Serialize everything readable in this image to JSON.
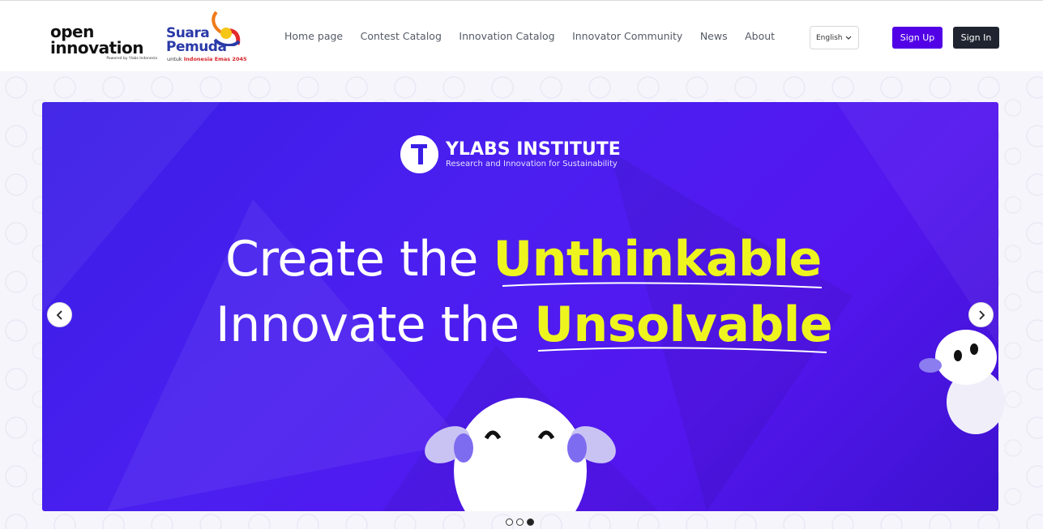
{
  "header": {
    "logo_open": {
      "line1": "open",
      "line2": "innovation",
      "powered": "Powered by Ylabs Indonesia"
    },
    "logo_suara": {
      "line1": "Suara",
      "line2": "Pemuda",
      "tag_prefix": "untuk",
      "tag_highlight": "Indonesia Emas 2045"
    },
    "nav": [
      "Home page",
      "Contest Catalog",
      "Innovation Catalog",
      "Innovator Community",
      "News",
      "About"
    ],
    "language": {
      "selected": "English",
      "icon": "chevron-down-icon"
    },
    "signup_label": "Sign Up",
    "signin_label": "Sign In"
  },
  "banner": {
    "brand_title": "YLABS INSTITUTE",
    "brand_subtitle": "Research and Innovation for Sustainability",
    "line1_plain": "Create the ",
    "line1_highlight": "Unthinkable",
    "line2_plain": "Innovate the ",
    "line2_highlight": "Unsolvable",
    "highlight_color": "#eef51e",
    "bg_color": "#4b1ff0"
  },
  "carousel": {
    "prev_icon": "chevron-left-icon",
    "next_icon": "chevron-right-icon",
    "total_slides": 3,
    "active_slide": 3
  },
  "colors": {
    "accent": "#5200e6",
    "dark": "#1f2430"
  }
}
